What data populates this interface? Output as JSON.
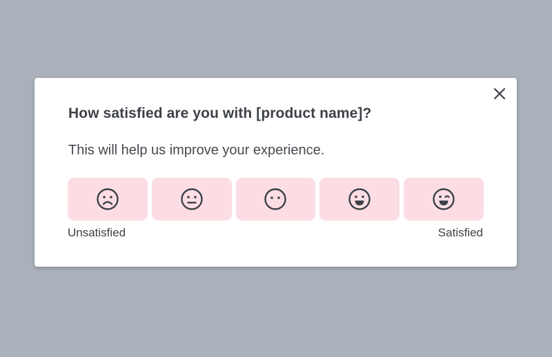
{
  "dialog": {
    "title": "How satisfied are you with [product name]?",
    "subtitle": "This will help us improve your experience.",
    "close_icon": "close-icon",
    "ratings": [
      {
        "icon": "very-unhappy-face-icon"
      },
      {
        "icon": "unhappy-face-icon"
      },
      {
        "icon": "neutral-face-icon"
      },
      {
        "icon": "happy-face-icon"
      },
      {
        "icon": "very-happy-face-icon"
      }
    ],
    "scale_min_label": "Unsatisfied",
    "scale_max_label": "Satisfied"
  },
  "colors": {
    "backdrop": "#abb1ba",
    "card": "#ffffff",
    "rating_button": "#fcdde4",
    "icon": "#3d4148",
    "text": "#3d4148"
  }
}
